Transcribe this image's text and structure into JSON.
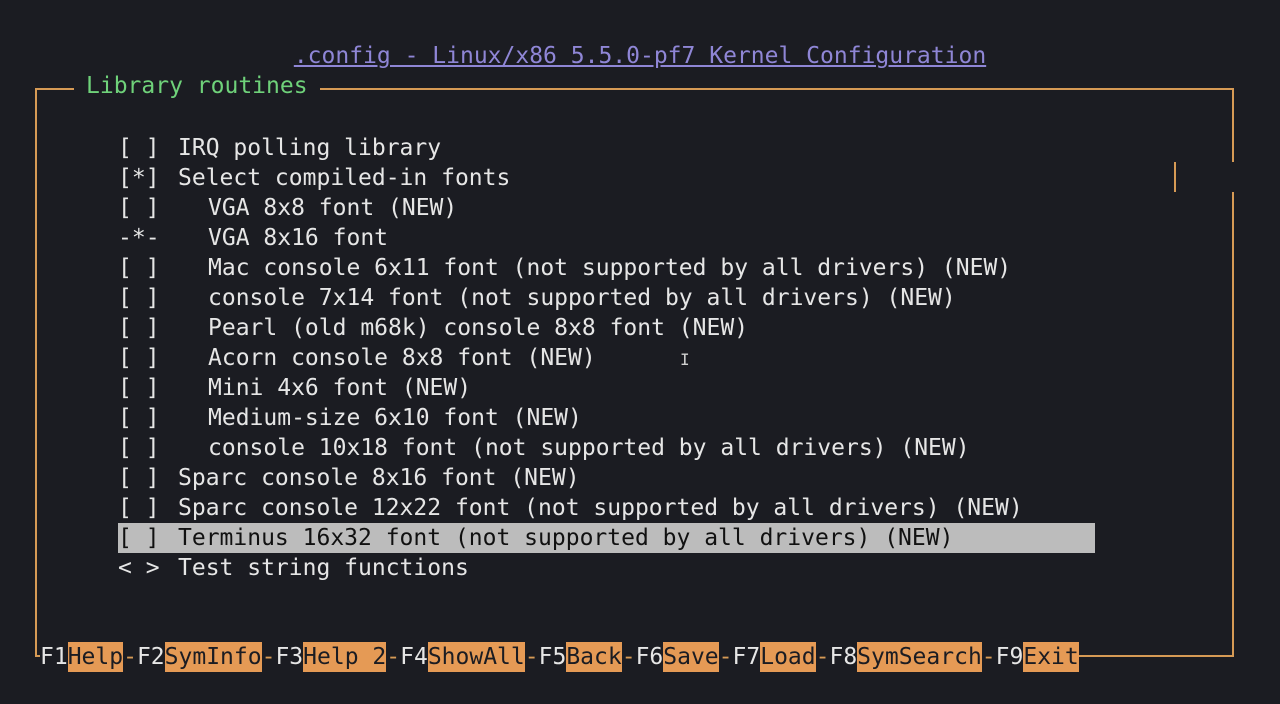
{
  "window_title": ".config - Linux/x86 5.5.0-pf7 Kernel Configuration",
  "menu_title": "Library routines",
  "items": [
    {
      "mark": "[ ]",
      "label": "IRQ polling library",
      "indent": 0
    },
    {
      "mark": "[*]",
      "label": "Select compiled-in fonts",
      "indent": 0
    },
    {
      "mark": "[ ]",
      "label": "VGA 8x8 font (NEW)",
      "indent": 1
    },
    {
      "mark": "-*-",
      "label": "VGA 8x16 font",
      "indent": 1
    },
    {
      "mark": "[ ]",
      "label": "Mac console 6x11 font (not supported by all drivers) (NEW)",
      "indent": 1
    },
    {
      "mark": "[ ]",
      "label": "console 7x14 font (not supported by all drivers) (NEW)",
      "indent": 1
    },
    {
      "mark": "[ ]",
      "label": "Pearl (old m68k) console 8x8 font (NEW)",
      "indent": 1
    },
    {
      "mark": "[ ]",
      "label": "Acorn console 8x8 font (NEW)",
      "indent": 1
    },
    {
      "mark": "[ ]",
      "label": "Mini 4x6 font (NEW)",
      "indent": 1
    },
    {
      "mark": "[ ]",
      "label": "Medium-size 6x10 font (NEW)",
      "indent": 1
    },
    {
      "mark": "[ ]",
      "label": "console 10x18 font (not supported by all drivers) (NEW)",
      "indent": 1
    },
    {
      "mark": "[ ]",
      "label": "Sparc console 8x16 font (NEW)",
      "indent": 0
    },
    {
      "mark": "[ ]",
      "label": "Sparc console 12x22 font (not supported by all drivers) (NEW)",
      "indent": 0
    },
    {
      "mark": "[ ]",
      "label": "Terminus 16x32 font (not supported by all drivers) (NEW)",
      "indent": 0,
      "selected": true
    },
    {
      "mark": "< >",
      "label": "Test string functions",
      "indent": 0
    }
  ],
  "cursor_glyph": "I",
  "function_keys": [
    {
      "key": "F1",
      "label": "Help"
    },
    {
      "key": "F2",
      "label": "SymInfo"
    },
    {
      "key": "F3",
      "label": "Help 2"
    },
    {
      "key": "F4",
      "label": "ShowAll"
    },
    {
      "key": "F5",
      "label": "Back"
    },
    {
      "key": "F6",
      "label": "Save"
    },
    {
      "key": "F7",
      "label": "Load"
    },
    {
      "key": "F8",
      "label": "SymSearch"
    },
    {
      "key": "F9",
      "label": "Exit"
    }
  ],
  "colors": {
    "background": "#1b1c22",
    "border": "#d69a55",
    "title": "#8f86d6",
    "menu_title": "#6fd27a",
    "selection": "#bcbcbc",
    "key_label_bg": "#e59a55"
  }
}
